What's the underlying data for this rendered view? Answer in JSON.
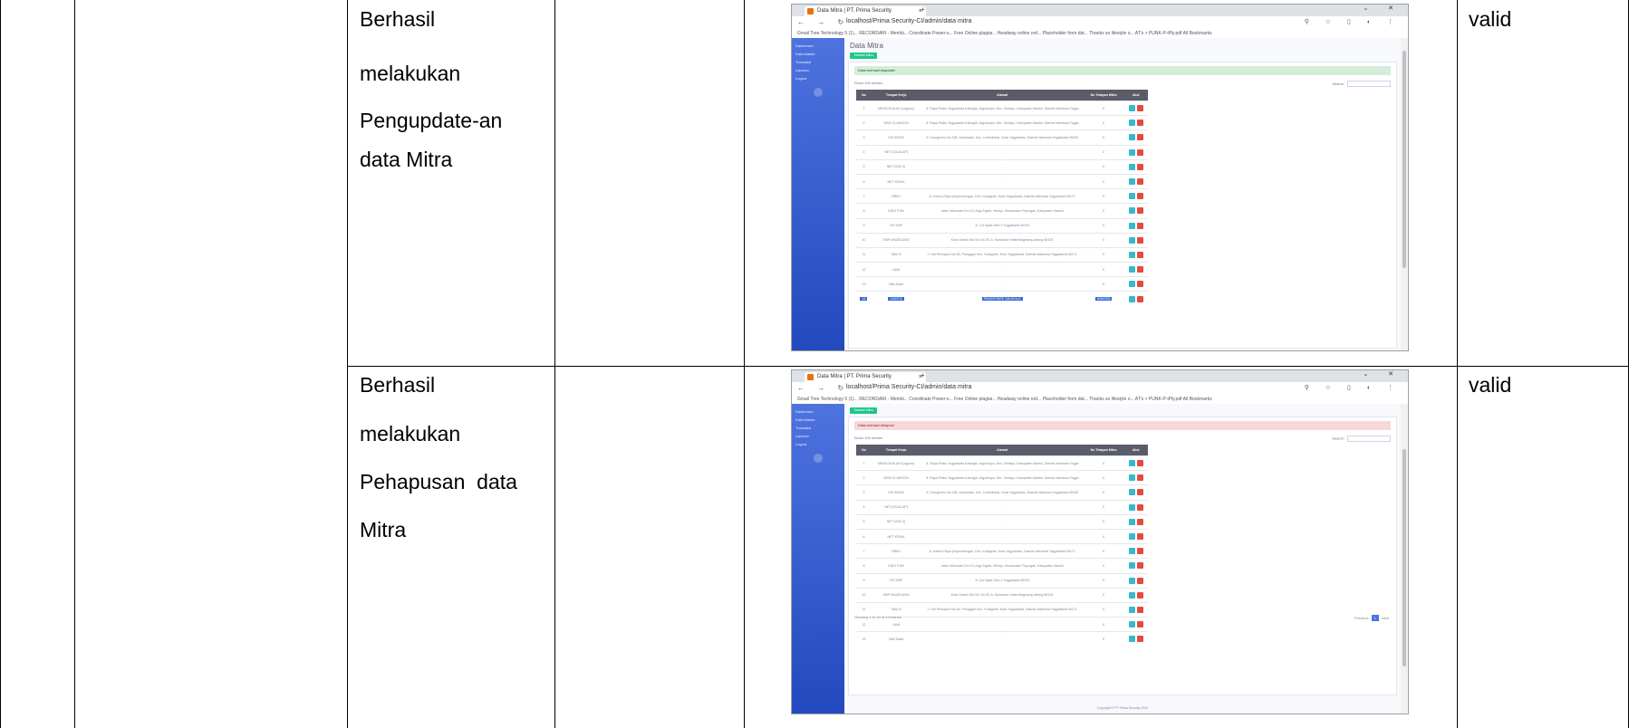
{
  "rows": [
    {
      "description_lines": [
        "Berhasil",
        "melakukan",
        "Pengupdate-an",
        "data Mitra"
      ],
      "result": "valid",
      "screenshot": {
        "tab_title": "Data Mitra | PT. Prima Security",
        "url": "localhost/Prima Security-CI/admin/data mitra",
        "bookmarks": "Gmail   Tree Technology 5 (1)...   RECORDARI - Membi...   Coordinate Power-s...   Free Online plagiar...   Headway online ord...   Placeholder from dat...   Thanks so lifestyle o...   AT's > PUNK-P-iPly.pdf          All Bookmarks",
        "page_title": "Data Mitra",
        "add_button": "Tambah Mitra",
        "alert": "Data berhasil diupdate!",
        "alert_type": "green",
        "show_entries": "Show  100  entries",
        "search_label": "Search:",
        "columns": [
          "No",
          "Tempat Kerja",
          "Alamat",
          "No Tetapan Mitra",
          "Aksi"
        ],
        "table": [
          {
            "no": "1",
            "tempat": "MENCOKALAH (Lagoon)",
            "alamat": "Jl. Raya Prabu Yogyakarta Kalongik, Argomulyo, Kec. Sedayu, Kabupaten Bantul, Daerah Istimewa Yogya",
            "nomor": "0"
          },
          {
            "no": "2",
            "tempat": "NEW CLAWSON",
            "alamat": "Jl. Raya Prabu Yogyakarta Kalongik, Argomulyo, Kec. Sedayu, Kabupaten Bantul, Daerah Istimewa Yogya",
            "nomor": "0"
          },
          {
            "no": "3",
            "tempat": "KIE KRIUK",
            "alamat": "Jl. Sorogenen No.198, Sorosutan, Kec. Umbulharjo, Kota Yogyakarta, Daerah Istimewa Yogyakarta 55162",
            "nomor": "0"
          },
          {
            "no": "4",
            "tempat": "NET (CILACAP)",
            "alamat": "-",
            "nomor": "0"
          },
          {
            "no": "5",
            "tempat": "NET (SOLO)",
            "alamat": "-",
            "nomor": "0"
          },
          {
            "no": "6",
            "tempat": "NET KRIUK",
            "alamat": "-",
            "nomor": "0"
          },
          {
            "no": "7",
            "tempat": "BRIKI",
            "alamat": "Jl. Kebun Raya (Kepeneringan, Kec. Kotagede, Kota Yogyakarta, Daerah Istimewa Yogyakarta 55171",
            "nomor": "0"
          },
          {
            "no": "8",
            "tempat": "KIDO PUN",
            "alamat": "Jalan Wonosari Km 10, Argo Ngelo, Mlirejo, Kecamatan Piyungan, Kabupaten Bantul",
            "nomor": "0"
          },
          {
            "no": "9",
            "tempat": "RS SMP",
            "alamat": "Jl. Cut Nyak Dien 2 Yogyakarta 55233",
            "nomor": "0"
          },
          {
            "no": "10",
            "tempat": "SMP MAGELANG",
            "alamat": "Kota Grand Vita No 15-D5, A. Soekarno Hatta Magelang Jateng 56125",
            "nomor": "0"
          },
          {
            "no": "11",
            "tempat": "SMU 8",
            "alamat": "J. Hol Pemayun No.08, Prenggan Kec. Kotagede, Kota Yogyakarta, Daerah Istimewa Yogyakarta 55172",
            "nomor": "0"
          },
          {
            "no": "12",
            "tempat": "LAVA",
            "alamat": "-",
            "nomor": "0"
          },
          {
            "no": "13",
            "tempat": "Villa Zidan",
            "alamat": "-",
            "nomor": "0"
          },
          {
            "no": "14",
            "tempat": "CAKS B",
            "alamat": "PANGPOKRE SALIKOLA",
            "nomor": "MIMOSA",
            "selected": true
          }
        ],
        "footer_info": "",
        "pager_prev": "",
        "pager_page": "",
        "pager_next": "",
        "copyright": ""
      }
    },
    {
      "description_lines": [
        "Berhasil",
        "melakukan",
        "Pehapusan  data",
        "Mitra"
      ],
      "result": "valid",
      "screenshot": {
        "tab_title": "Data Mitra | PT. Prima Security",
        "url": "localhost/Prima Security-CI/admin/data mitra",
        "bookmarks": "Gmail   Tree Technology 5 (1)...   RECORDARI - Membi...   Coordinate Power-s...   Free Online plagiar...   Headway online ord...   Placeholder from dat...   Thanks so lifestyle o...   AT's > PUNK-P-iPly.pdf          All Bookmarks",
        "page_title": "",
        "add_button": "Tambah Mitra",
        "alert": "Data berhasil dihapus!",
        "alert_type": "red",
        "show_entries": "Show  100  entries",
        "search_label": "Search:",
        "columns": [
          "No",
          "Tempat Kerja",
          "Alamat",
          "No Tetapan Mitra",
          "Aksi"
        ],
        "table": [
          {
            "no": "1",
            "tempat": "MENCOKALAH (Lagoon)",
            "alamat": "Jl. Raya Prabu Yogyakarta Kalongik, Argomulyo, Kec. Sedayu, Kabupaten Bantul, Daerah Istimewa Yogya",
            "nomor": "0"
          },
          {
            "no": "2",
            "tempat": "NEW CLAWSON",
            "alamat": "Jl. Raya Prabu Yogyakarta Kalongik, Argomulyo, Kec. Sedayu, Kabupaten Bantul, Daerah Istimewa Yogya",
            "nomor": "0"
          },
          {
            "no": "3",
            "tempat": "KIE KRIUK",
            "alamat": "Jl. Sorogenen No.198, Sorosutan, Kec. Umbulharjo, Kota Yogyakarta, Daerah Istimewa Yogyakarta 55162",
            "nomor": "0"
          },
          {
            "no": "4",
            "tempat": "NET (CILACAP)",
            "alamat": "-",
            "nomor": "0"
          },
          {
            "no": "5",
            "tempat": "NET (SOLO)",
            "alamat": "-",
            "nomor": "0"
          },
          {
            "no": "6",
            "tempat": "NET KRIUK",
            "alamat": "-",
            "nomor": "0"
          },
          {
            "no": "7",
            "tempat": "BRIKI",
            "alamat": "Jl. Kebun Raya (Kepeneringan, Kec. Kotagede, Kota Yogyakarta, Daerah Istimewa Yogyakarta 55171",
            "nomor": "0"
          },
          {
            "no": "8",
            "tempat": "KIDO PUN",
            "alamat": "Jalan Wonosari Km 10, Argo Ngelo, Mlirejo, Kecamatan Piyungan, Kabupaten Bantul",
            "nomor": "0"
          },
          {
            "no": "9",
            "tempat": "RS SMP",
            "alamat": "Jl. Cut Nyak Dien 2 Yogyakarta 55233",
            "nomor": "0"
          },
          {
            "no": "10",
            "tempat": "SMP MAGELANG",
            "alamat": "Kota Grand Vita No 15-D5, A. Soekarno Hatta Magelang Jateng 56125",
            "nomor": "0"
          },
          {
            "no": "11",
            "tempat": "SMU 8",
            "alamat": "J. Hol Pemayun No.08, Prenggan Kec. Kotagede, Kota Yogyakarta, Daerah Istimewa Yogyakarta 55172",
            "nomor": "0"
          },
          {
            "no": "12",
            "tempat": "LAVA",
            "alamat": "-",
            "nomor": "0"
          },
          {
            "no": "13",
            "tempat": "Villa Zidan",
            "alamat": "-",
            "nomor": "0"
          }
        ],
        "footer_info": "Showing 1 to 13 of 13 entries",
        "pager_prev": "Previous",
        "pager_page": "1",
        "pager_next": "Next",
        "copyright": "Copyright © PT Prima Security 2024"
      }
    }
  ],
  "sidebar_items": [
    "Dashboard",
    "Data Master",
    "Transaksi",
    "Laporan",
    "Logout"
  ]
}
